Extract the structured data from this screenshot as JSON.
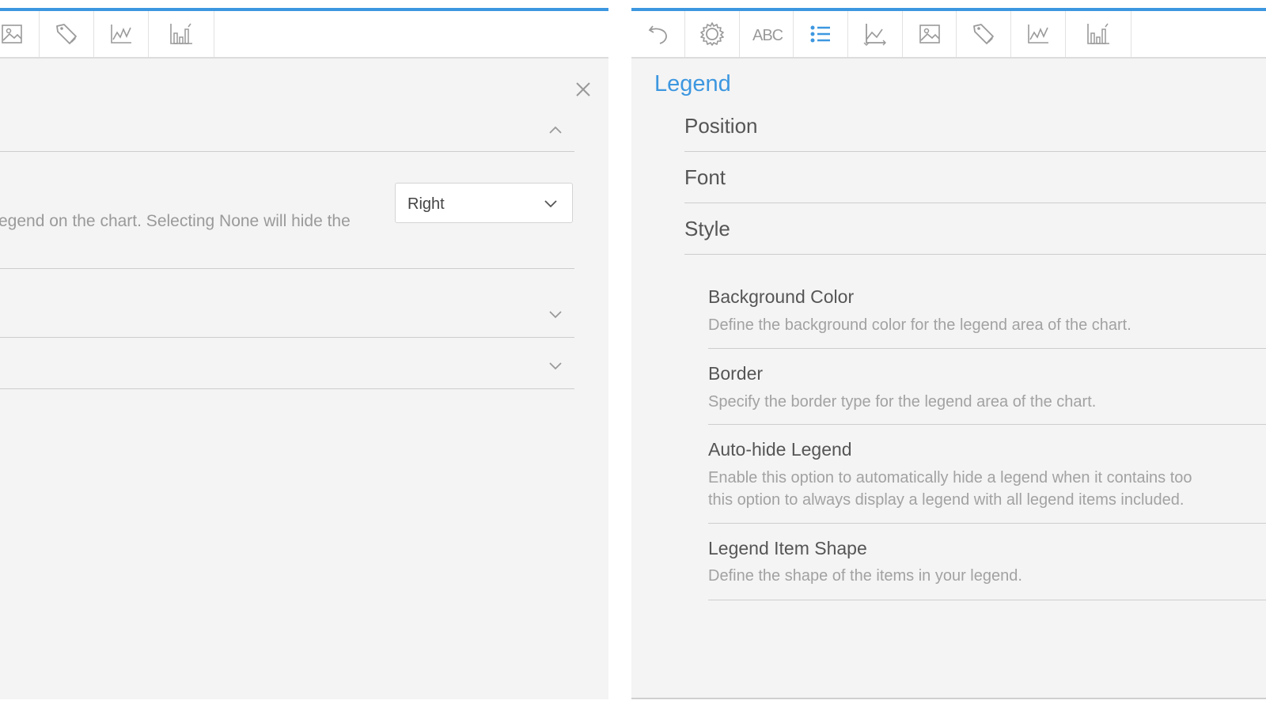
{
  "colors": {
    "accent": "#3d97e0",
    "panel_bg": "#f4f4f4",
    "divider": "#cdcdcd",
    "muted_text": "#9a9a9a"
  },
  "left_panel": {
    "toolbar_icons": [
      "image-icon",
      "tag-icon",
      "line-chart-icon",
      "bar-chart-icon"
    ],
    "close_icon": "close-icon",
    "position_select": {
      "value": "Right"
    },
    "position_description": "egend on the chart. Selecting None will hide the"
  },
  "right_panel": {
    "toolbar_icons": [
      "undo-icon",
      "gear-icon",
      "abc-text-icon",
      "list-icon",
      "axis-chart-icon",
      "image-icon",
      "tag-icon",
      "line-chart-icon",
      "bar-chart-icon"
    ],
    "active_icon": "list-icon",
    "title": "Legend",
    "sections": [
      "Position",
      "Font",
      "Style"
    ],
    "style_options": [
      {
        "title": "Background Color",
        "description": [
          "Define the background color for the legend area of the chart."
        ]
      },
      {
        "title": "Border",
        "description": [
          "Specify the border type for the legend area of the chart."
        ]
      },
      {
        "title": "Auto-hide Legend",
        "description": [
          "Enable this option to automatically hide a legend when it contains too",
          "this option to always display a legend with all legend items included."
        ]
      },
      {
        "title": "Legend Item Shape",
        "description": [
          "Define the shape of the items in your legend."
        ]
      }
    ]
  }
}
